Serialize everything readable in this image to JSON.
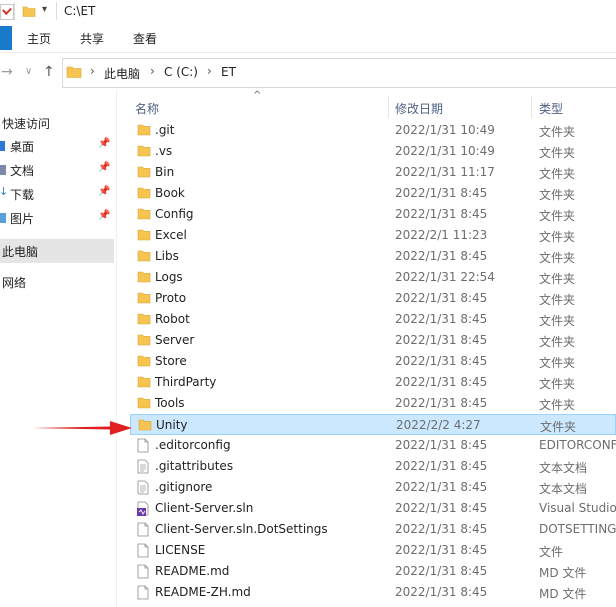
{
  "window": {
    "title": "C:\\ET"
  },
  "ribbon": {
    "tabs": [
      "主页",
      "共享",
      "查看"
    ]
  },
  "address": {
    "crumbs": [
      "此电脑",
      "C (C:)",
      "ET"
    ]
  },
  "nav_pane": {
    "quick_access": "快速访问",
    "items": [
      {
        "label": "桌面",
        "pinned": true
      },
      {
        "label": "文档",
        "pinned": true
      },
      {
        "label": "下载",
        "pinned": true
      },
      {
        "label": "图片",
        "pinned": true
      }
    ],
    "this_pc": "此电脑",
    "network": "网络"
  },
  "columns": {
    "name": "名称",
    "date": "修改日期",
    "type": "类型"
  },
  "files": [
    {
      "name": ".git",
      "date": "2022/1/31 10:49",
      "type": "文件夹",
      "icon": "folder"
    },
    {
      "name": ".vs",
      "date": "2022/1/31 10:49",
      "type": "文件夹",
      "icon": "folder"
    },
    {
      "name": "Bin",
      "date": "2022/1/31 11:17",
      "type": "文件夹",
      "icon": "folder"
    },
    {
      "name": "Book",
      "date": "2022/1/31 8:45",
      "type": "文件夹",
      "icon": "folder"
    },
    {
      "name": "Config",
      "date": "2022/1/31 8:45",
      "type": "文件夹",
      "icon": "folder"
    },
    {
      "name": "Excel",
      "date": "2022/2/1 11:23",
      "type": "文件夹",
      "icon": "folder"
    },
    {
      "name": "Libs",
      "date": "2022/1/31 8:45",
      "type": "文件夹",
      "icon": "folder"
    },
    {
      "name": "Logs",
      "date": "2022/1/31 22:54",
      "type": "文件夹",
      "icon": "folder"
    },
    {
      "name": "Proto",
      "date": "2022/1/31 8:45",
      "type": "文件夹",
      "icon": "folder"
    },
    {
      "name": "Robot",
      "date": "2022/1/31 8:45",
      "type": "文件夹",
      "icon": "folder"
    },
    {
      "name": "Server",
      "date": "2022/1/31 8:45",
      "type": "文件夹",
      "icon": "folder"
    },
    {
      "name": "Store",
      "date": "2022/1/31 8:45",
      "type": "文件夹",
      "icon": "folder"
    },
    {
      "name": "ThirdParty",
      "date": "2022/1/31 8:45",
      "type": "文件夹",
      "icon": "folder"
    },
    {
      "name": "Tools",
      "date": "2022/1/31 8:45",
      "type": "文件夹",
      "icon": "folder"
    },
    {
      "name": "Unity",
      "date": "2022/2/2 4:27",
      "type": "文件夹",
      "icon": "folder",
      "selected": true
    },
    {
      "name": ".editorconfig",
      "date": "2022/1/31 8:45",
      "type": "EDITORCONF",
      "icon": "file"
    },
    {
      "name": ".gitattributes",
      "date": "2022/1/31 8:45",
      "type": "文本文档",
      "icon": "text-file"
    },
    {
      "name": ".gitignore",
      "date": "2022/1/31 8:45",
      "type": "文本文档",
      "icon": "text-file"
    },
    {
      "name": "Client-Server.sln",
      "date": "2022/1/31 8:45",
      "type": "Visual Studio",
      "icon": "vs-solution"
    },
    {
      "name": "Client-Server.sln.DotSettings",
      "date": "2022/1/31 8:45",
      "type": "DOTSETTING",
      "icon": "file"
    },
    {
      "name": "LICENSE",
      "date": "2022/1/31 8:45",
      "type": "文件",
      "icon": "file"
    },
    {
      "name": "README.md",
      "date": "2022/1/31 8:45",
      "type": "MD 文件",
      "icon": "file"
    },
    {
      "name": "README-ZH.md",
      "date": "2022/1/31 8:45",
      "type": "MD 文件",
      "icon": "file"
    }
  ],
  "colors": {
    "folder": "#f5c451",
    "selection": "#cce8ff",
    "arrow": "#e02020"
  }
}
